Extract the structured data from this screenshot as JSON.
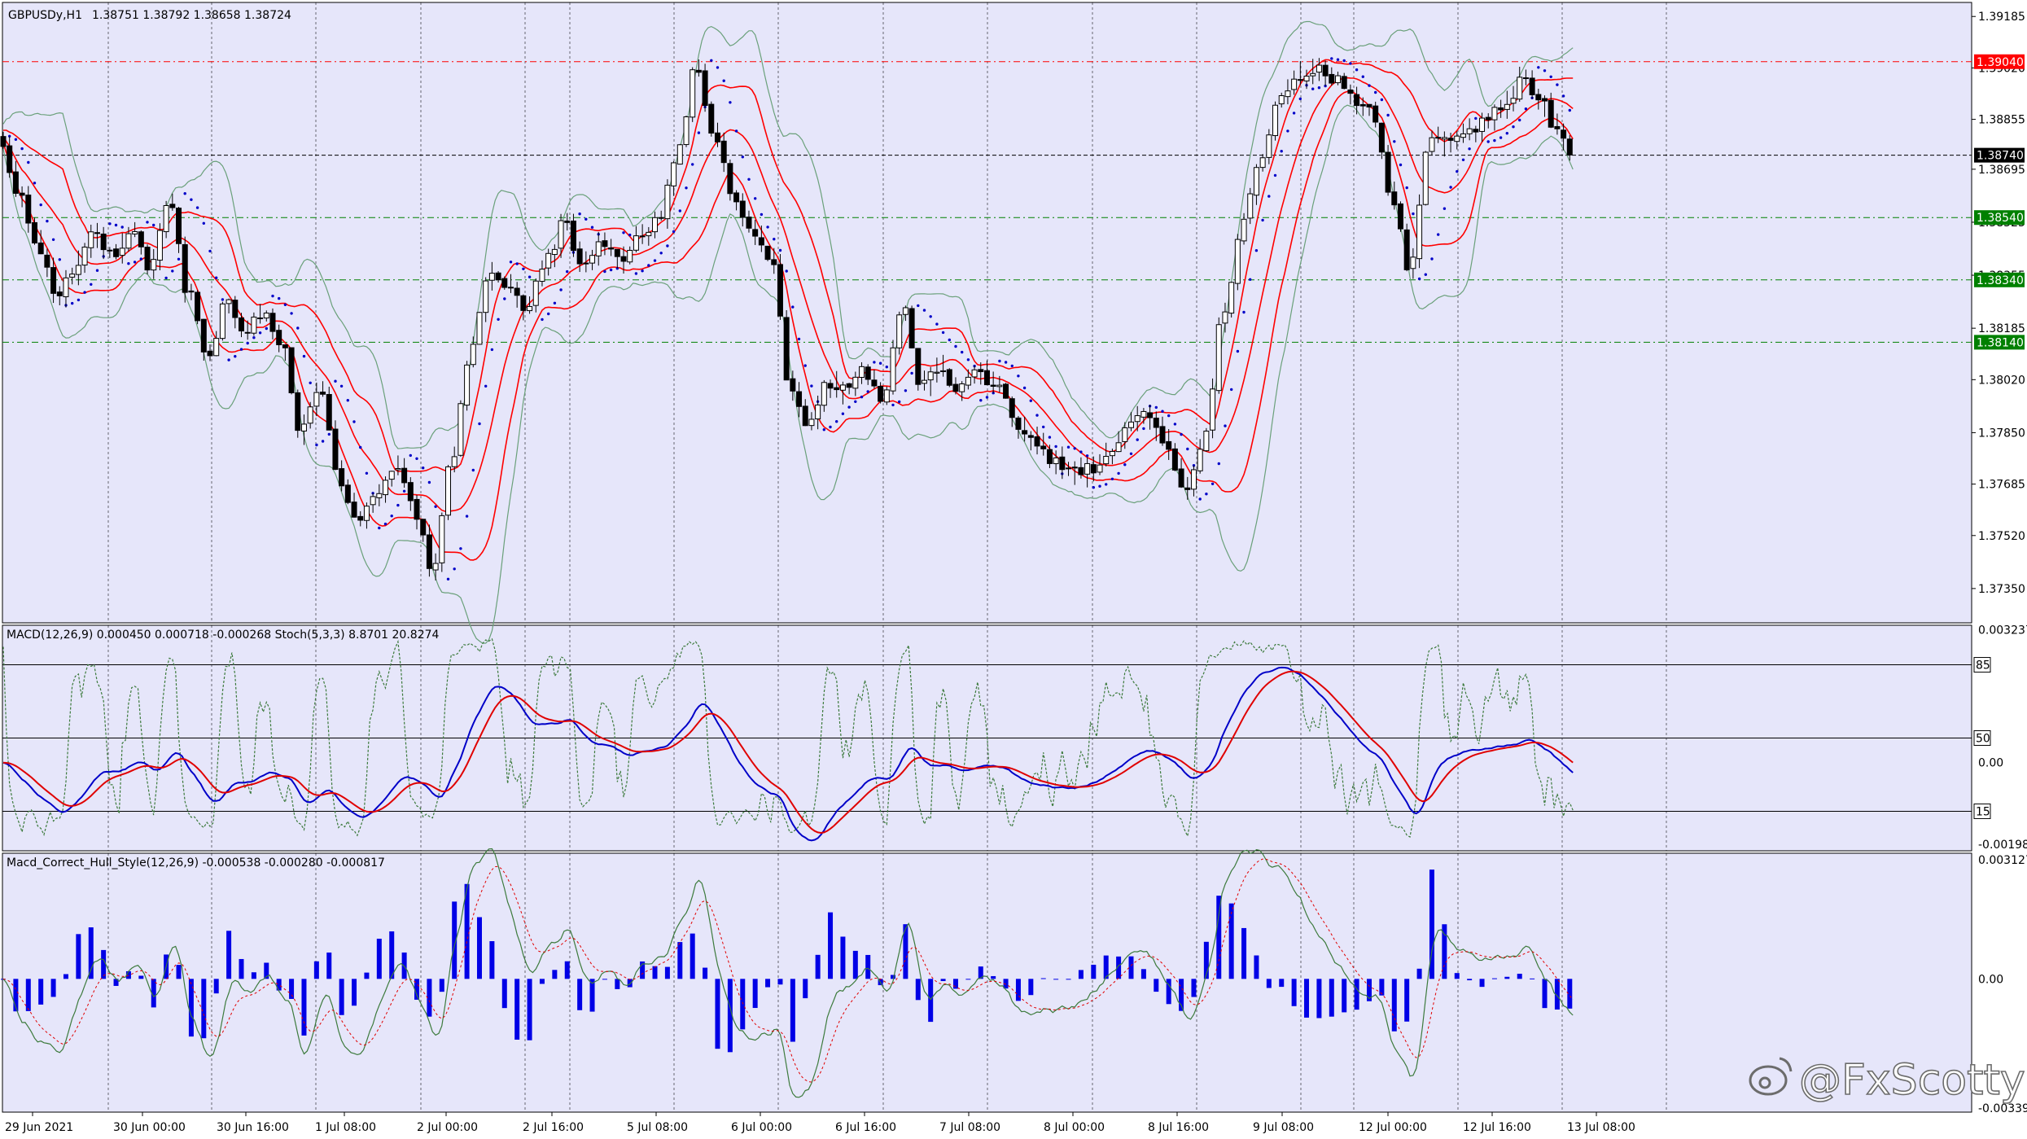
{
  "chart_data": {
    "type": "candlestick",
    "symbol_label": "GBPUSDy,H1",
    "ohlc_label": "1.38751 1.38792 1.38658 1.38724",
    "colors": {
      "background": "#e6e6fa",
      "grid": "#000000",
      "bull_body": "#ffffff",
      "bear_body": "#000000",
      "bollinger_mid": "#ff0000",
      "bollinger_outer": "#6aa07a",
      "sar": "#0000c8",
      "macd": "#0000c8",
      "signal": "#e00000",
      "stoch": "#3c7a3c",
      "hist": "#0000e6",
      "level_red": "#ff0000",
      "level_green": "#008000"
    },
    "price_axis": {
      "min": 1.3724,
      "max": 1.3923,
      "ticks": [
        "1.39185",
        "1.39020",
        "1.38855",
        "1.38695",
        "1.38525",
        "1.38355",
        "1.38185",
        "1.38020",
        "1.37850",
        "1.37685",
        "1.37520",
        "1.37350"
      ]
    },
    "time_axis": [
      "29 Jun 2021",
      "30 Jun 00:00",
      "30 Jun 16:00",
      "1 Jul 08:00",
      "2 Jul 00:00",
      "2 Jul 16:00",
      "5 Jul 08:00",
      "6 Jul 00:00",
      "6 Jul 16:00",
      "7 Jul 08:00",
      "8 Jul 00:00",
      "8 Jul 16:00",
      "9 Jul 08:00",
      "12 Jul 00:00",
      "12 Jul 16:00",
      "13 Jul 08:00"
    ],
    "levels": [
      {
        "price": 1.3904,
        "label": "1.39040",
        "kind": "red"
      },
      {
        "price": 1.3874,
        "label": "1.38740",
        "kind": "current"
      },
      {
        "price": 1.3854,
        "label": "1.38540",
        "kind": "green"
      },
      {
        "price": 1.3834,
        "label": "1.38340",
        "kind": "green"
      },
      {
        "price": 1.3814,
        "label": "1.38140",
        "kind": "green"
      }
    ],
    "price_path": [
      [
        0,
        1.3878
      ],
      [
        6,
        1.386
      ],
      [
        12,
        1.3845
      ],
      [
        18,
        1.383
      ],
      [
        24,
        1.3838
      ],
      [
        30,
        1.3848
      ],
      [
        36,
        1.3842
      ],
      [
        42,
        1.385
      ],
      [
        48,
        1.3838
      ],
      [
        54,
        1.3858
      ],
      [
        60,
        1.383
      ],
      [
        66,
        1.3808
      ],
      [
        72,
        1.3826
      ],
      [
        78,
        1.3818
      ],
      [
        84,
        1.3822
      ],
      [
        90,
        1.3812
      ],
      [
        96,
        1.3785
      ],
      [
        102,
        1.38
      ],
      [
        108,
        1.377
      ],
      [
        114,
        1.3758
      ],
      [
        120,
        1.3763
      ],
      [
        126,
        1.3775
      ],
      [
        132,
        1.376
      ],
      [
        138,
        1.374
      ],
      [
        144,
        1.3775
      ],
      [
        150,
        1.381
      ],
      [
        156,
        1.3835
      ],
      [
        162,
        1.3832
      ],
      [
        168,
        1.3824
      ],
      [
        174,
        1.384
      ],
      [
        180,
        1.3852
      ],
      [
        186,
        1.3838
      ],
      [
        192,
        1.3845
      ],
      [
        198,
        1.384
      ],
      [
        204,
        1.385
      ],
      [
        210,
        1.3852
      ],
      [
        216,
        1.3875
      ],
      [
        222,
        1.3902
      ],
      [
        228,
        1.388
      ],
      [
        234,
        1.3862
      ],
      [
        240,
        1.3848
      ],
      [
        246,
        1.3842
      ],
      [
        252,
        1.38
      ],
      [
        258,
        1.3788
      ],
      [
        264,
        1.38
      ],
      [
        270,
        1.3798
      ],
      [
        276,
        1.3805
      ],
      [
        282,
        1.3795
      ],
      [
        288,
        1.3825
      ],
      [
        294,
        1.38
      ],
      [
        300,
        1.3806
      ],
      [
        306,
        1.3798
      ],
      [
        312,
        1.3805
      ],
      [
        318,
        1.38
      ],
      [
        324,
        1.3788
      ],
      [
        330,
        1.3783
      ],
      [
        336,
        1.3776
      ],
      [
        342,
        1.3772
      ],
      [
        348,
        1.3773
      ],
      [
        354,
        1.378
      ],
      [
        360,
        1.3788
      ],
      [
        366,
        1.379
      ],
      [
        372,
        1.3782
      ],
      [
        378,
        1.3768
      ],
      [
        384,
        1.3782
      ],
      [
        390,
        1.382
      ],
      [
        396,
        1.385
      ],
      [
        402,
        1.3872
      ],
      [
        408,
        1.3893
      ],
      [
        414,
        1.39
      ],
      [
        420,
        1.3902
      ],
      [
        426,
        1.3898
      ],
      [
        432,
        1.3892
      ],
      [
        438,
        1.3888
      ],
      [
        444,
        1.386
      ],
      [
        450,
        1.3838
      ],
      [
        456,
        1.388
      ],
      [
        462,
        1.3878
      ],
      [
        468,
        1.3882
      ],
      [
        474,
        1.3885
      ],
      [
        480,
        1.389
      ],
      [
        486,
        1.3898
      ],
      [
        492,
        1.389
      ],
      [
        498,
        1.388
      ],
      [
        502,
        1.3873
      ]
    ],
    "bars_total": 502,
    "macd_panel": {
      "label": "MACD(12,26,9) 0.000450 0.000718 -0.000268  Stoch(5,3,3) 8.8701 20.8274",
      "axis_min": -0.00215,
      "axis_max": 0.00335,
      "ticks": [
        {
          "v": 0.003237,
          "label": "0.003237"
        },
        {
          "v": 0.0,
          "label": "0.00"
        },
        {
          "v": -0.001988,
          "label": "-0.001988"
        }
      ],
      "stoch_levels": [
        {
          "v": 85,
          "label": "85"
        },
        {
          "v": 50,
          "label": "50"
        },
        {
          "v": 15,
          "label": "15"
        }
      ]
    },
    "hull_panel": {
      "label": "Macd_Correct_Hull_Style(12,26,9) -0.000538 -0.000280 -0.000817",
      "axis_min": -0.0035,
      "axis_max": 0.0033,
      "ticks": [
        {
          "v": 0.003127,
          "label": "0.003127"
        },
        {
          "v": 0.0,
          "label": "0.00"
        },
        {
          "v": -0.003391,
          "label": "-0.003391"
        }
      ]
    },
    "watermark": "@FxScotty"
  }
}
